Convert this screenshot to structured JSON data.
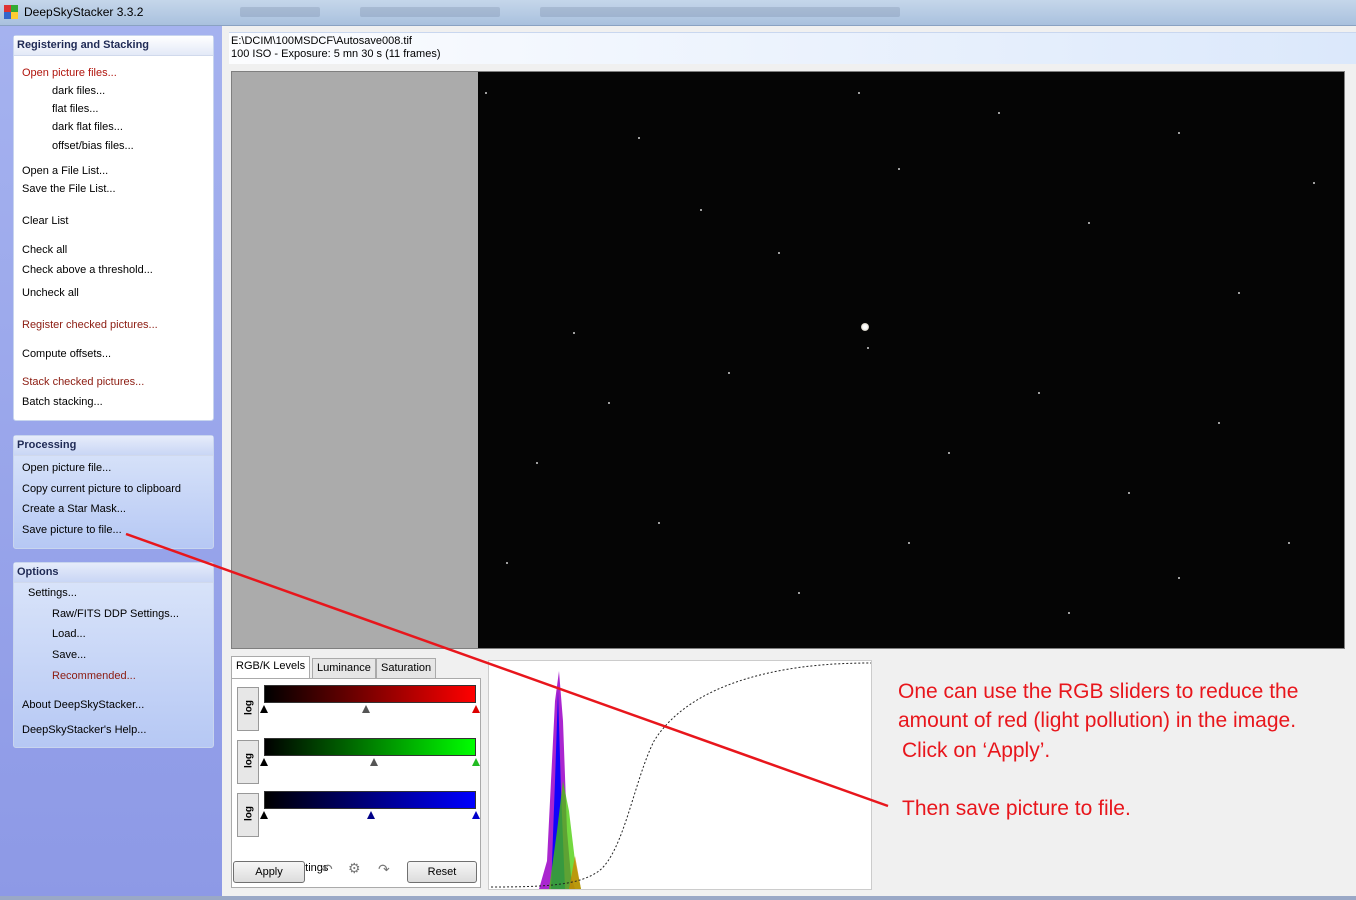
{
  "window": {
    "title": "DeepSkyStacker 3.3.2"
  },
  "registering": {
    "title": "Registering and Stacking",
    "open_picture_files": "Open picture files...",
    "dark_files": "dark files...",
    "flat_files": "flat files...",
    "dark_flat_files": "dark flat files...",
    "offset_bias_files": "offset/bias files...",
    "open_file_list": "Open a File List...",
    "save_file_list": "Save the File List...",
    "clear_list": "Clear List",
    "check_all": "Check all",
    "check_threshold": "Check above a threshold...",
    "uncheck_all": "Uncheck all",
    "register_checked": "Register checked pictures...",
    "compute_offsets": "Compute offsets...",
    "stack_checked": "Stack checked pictures...",
    "batch_stacking": "Batch stacking..."
  },
  "processing": {
    "title": "Processing",
    "open_picture_file": "Open picture file...",
    "copy_to_clipboard": "Copy current picture to clipboard",
    "create_star_mask": "Create a Star Mask...",
    "save_picture": "Save picture to file..."
  },
  "options": {
    "title": "Options",
    "settings": "Settings...",
    "raw_fits": "Raw/FITS DDP Settings...",
    "load": "Load...",
    "save": "Save...",
    "recommended": "Recommended...",
    "about": "About DeepSkyStacker...",
    "help": "DeepSkyStacker's Help..."
  },
  "file_info": {
    "path": "E:\\DCIM\\100MSDCF\\Autosave008.tif",
    "details": "100 ISO - Exposure: 5 mn 30 s (11 frames)"
  },
  "tabs": [
    "RGB/K Levels",
    "Luminance",
    "Saturation"
  ],
  "levels": {
    "log_label": "log",
    "linked_settings": "Linked settings",
    "apply": "Apply",
    "reset": "Reset",
    "sliders": [
      {
        "channel": "red",
        "color": "#ff0000",
        "low": 0.0,
        "mid": 0.48,
        "high": 1.0
      },
      {
        "channel": "green",
        "color": "#00ff00",
        "low": 0.0,
        "mid": 0.52,
        "high": 1.0
      },
      {
        "channel": "blue",
        "color": "#0000ff",
        "low": 0.0,
        "mid": 0.49,
        "high": 1.0
      }
    ]
  },
  "annotation": {
    "line1": "One can use the RGB sliders to reduce the",
    "line2": "amount of red (light pollution) in the image.",
    "line3": "Click on ‘Apply’.",
    "line4": "Then save picture to file.",
    "color": "#e8161c"
  },
  "icons": {
    "undo": "undo-icon",
    "settings": "gear-icon",
    "redo": "redo-icon"
  }
}
